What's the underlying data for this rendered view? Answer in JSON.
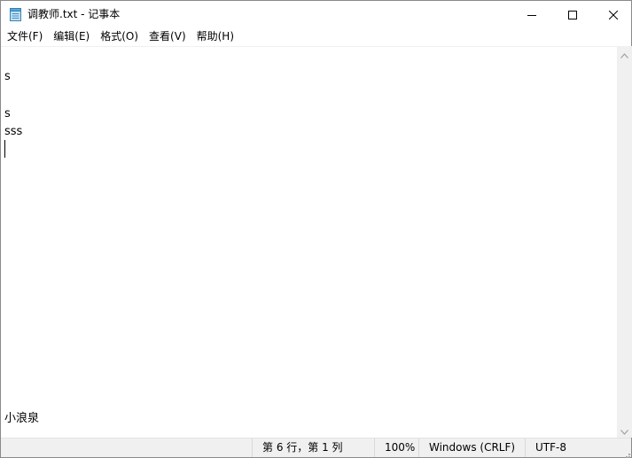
{
  "window": {
    "title": "调教师.txt - 记事本",
    "icon": "notepad-icon",
    "controls": {
      "minimize_icon": "minimize-icon",
      "maximize_icon": "maximize-icon",
      "close_icon": "close-icon"
    }
  },
  "menu": {
    "items": [
      {
        "label": "文件(F)"
      },
      {
        "label": "编辑(E)"
      },
      {
        "label": "格式(O)"
      },
      {
        "label": "查看(V)"
      },
      {
        "label": "帮助(H)"
      }
    ]
  },
  "editor": {
    "lines": [
      "",
      "s",
      "",
      "s",
      "sss",
      "",
      "小浪泉"
    ]
  },
  "statusbar": {
    "position": "第 6 行，第 1 列",
    "zoom": "100%",
    "line_ending": "Windows (CRLF)",
    "encoding": "UTF-8"
  },
  "colors": {
    "window_bg": "#ffffff",
    "statusbar_bg": "#f0f0f0",
    "scrollbar_bg": "#f0f0f0",
    "text": "#000000"
  }
}
